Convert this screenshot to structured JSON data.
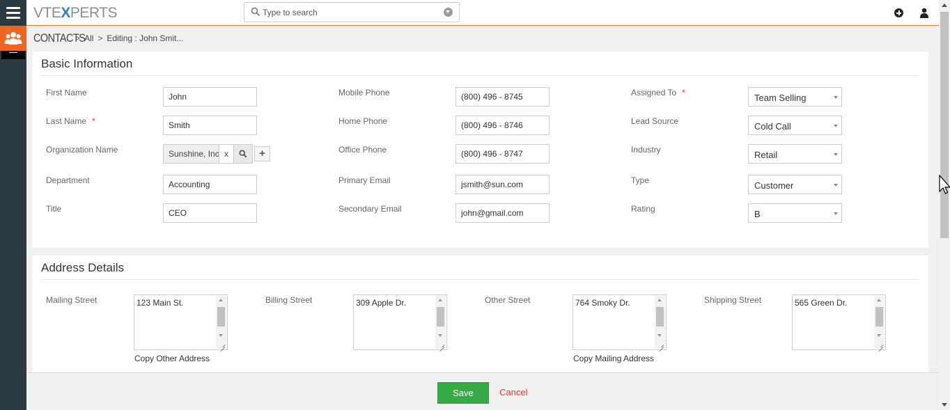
{
  "header": {
    "logo_left": "VTE",
    "logo_x": "X",
    "logo_right": "PERTS",
    "search_placeholder": "Type to search"
  },
  "breadcrumb": {
    "module": "CONTACTS",
    "all": "All",
    "editing": "Editing : John Smit..."
  },
  "basic": {
    "title": "Basic Information",
    "first_name_label": "First Name",
    "first_name": "John",
    "last_name_label": "Last Name",
    "last_name": "Smith",
    "org_label": "Organization Name",
    "org": "Sunshine, Inc",
    "org_clear": "x",
    "org_add": "+",
    "department_label": "Department",
    "department": "Accounting",
    "title_label": "Title",
    "title_value": "CEO",
    "mobile_label": "Mobile Phone",
    "mobile": "(800) 496 - 8745",
    "home_label": "Home Phone",
    "home": "(800) 496 - 8746",
    "office_label": "Office Phone",
    "office": "(800) 496 - 8747",
    "primary_email_label": "Primary Email",
    "primary_email": "jsmith@sun.com",
    "secondary_email_label": "Secondary Email",
    "secondary_email": "john@gmail.com",
    "assigned_label": "Assigned To",
    "assigned": "Team Selling",
    "lead_source_label": "Lead Source",
    "lead_source": "Cold Call",
    "industry_label": "Industry",
    "industry": "Retail",
    "type_label": "Type",
    "type": "Customer",
    "rating_label": "Rating",
    "rating": "B",
    "required_mark": "*"
  },
  "address": {
    "title": "Address Details",
    "mailing_label": "Mailing Street",
    "mailing": "123 Main St.",
    "billing_label": "Billing Street",
    "billing": "309 Apple Dr.",
    "other_label": "Other Street",
    "other": "764 Smoky Dr.",
    "shipping_label": "Shipping Street",
    "shipping": "565 Green Dr.",
    "copy_other": "Copy Other Address",
    "copy_mailing": "Copy Mailing Address"
  },
  "footer": {
    "save": "Save",
    "cancel": "Cancel"
  },
  "colors": {
    "accent": "#f06523",
    "sidebar": "#2b3a42",
    "save": "#35aa47",
    "cancel": "#e53935"
  }
}
